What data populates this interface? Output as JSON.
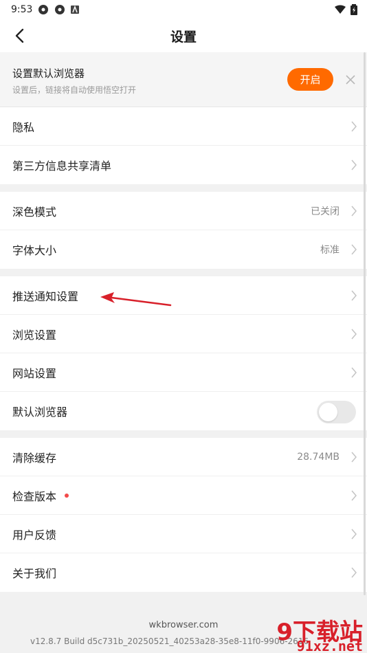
{
  "status_bar": {
    "time": "9:53"
  },
  "header": {
    "title": "设置"
  },
  "banner": {
    "title": "设置默认浏览器",
    "subtitle": "设置后，链接将自动使用悟空打开",
    "open_label": "开启"
  },
  "groups": {
    "g1": {
      "privacy": "隐私",
      "third_party": "第三方信息共享清单"
    },
    "g2": {
      "dark_mode": "深色模式",
      "dark_mode_value": "已关闭",
      "font_size": "字体大小",
      "font_size_value": "标准"
    },
    "g3": {
      "push": "推送通知设置",
      "browse": "浏览设置",
      "site": "网站设置",
      "default_browser": "默认浏览器",
      "default_browser_on": false
    },
    "g4": {
      "cache": "清除缓存",
      "cache_value": "28.74MB",
      "check_version": "检查版本",
      "feedback": "用户反馈",
      "about": "关于我们"
    }
  },
  "footer": {
    "site": "wkbrowser.com",
    "version": "v12.8.7 Build d5c731b_20250521_40253a28-35e8-11f0-9906-2616"
  },
  "watermark": {
    "brand": "9下载站",
    "url": "91xz.net"
  },
  "colors": {
    "accent": "#ff6a00",
    "badge": "#f24a4a",
    "annotation_arrow": "#d8202a"
  }
}
